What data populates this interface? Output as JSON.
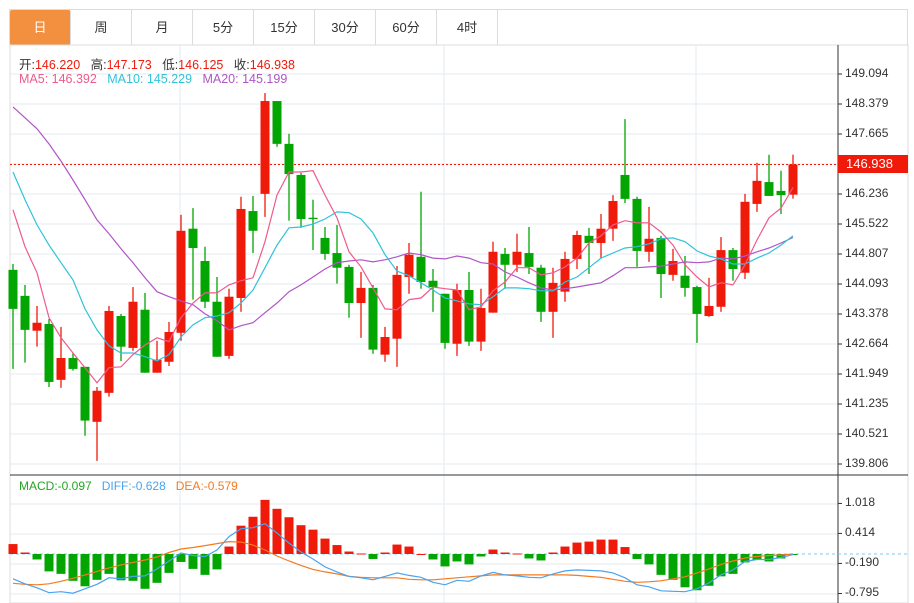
{
  "tabs": [
    {
      "label": "日",
      "active": true
    },
    {
      "label": "周"
    },
    {
      "label": "月"
    },
    {
      "label": "5分"
    },
    {
      "label": "15分"
    },
    {
      "label": "30分"
    },
    {
      "label": "60分"
    },
    {
      "label": "4时"
    }
  ],
  "ohlc_legend": {
    "open_label": "开:",
    "open": "146.220",
    "high_label": "高:",
    "high": "147.173",
    "low_label": "低:",
    "low": "146.125",
    "close_label": "收:",
    "close": "146.938"
  },
  "ma_legend": {
    "ma5": "MA5: 146.392",
    "ma10": "MA10: 145.229",
    "ma20": "MA20: 145.199"
  },
  "macd_legend": {
    "macd": "MACD:-0.097",
    "diff": "DIFF:-0.628",
    "dea": "DEA:-0.579"
  },
  "current_price": "146.938",
  "colors": {
    "up": "#f01a0a",
    "down": "#03a503",
    "ma5": "#ee5b8c",
    "ma10": "#2ec3d9",
    "ma20": "#b055c8",
    "diff": "#4aa3ee",
    "dea": "#f47a20",
    "accent": "#f39040"
  },
  "chart_data": [
    {
      "type": "candlestick",
      "price_axis": {
        "max": 149.094,
        "step": 0.7145,
        "labels": [
          "149.094",
          "148.379",
          "147.665",
          "",
          "146.236",
          "145.522",
          "144.807",
          "144.093",
          "143.378",
          "142.664",
          "141.949",
          "141.235",
          "140.521",
          "139.806"
        ]
      },
      "candles": [
        [
          144.43,
          144.57,
          142.07,
          143.5
        ],
        [
          143.81,
          144.07,
          142.22,
          143.0
        ],
        [
          142.98,
          143.57,
          142.6,
          143.17
        ],
        [
          143.14,
          143.26,
          141.64,
          141.76
        ],
        [
          141.81,
          143.07,
          141.62,
          142.33
        ],
        [
          142.33,
          142.45,
          142.03,
          142.07
        ],
        [
          142.12,
          142.12,
          140.48,
          140.84
        ],
        [
          140.81,
          141.64,
          139.88,
          141.55
        ],
        [
          141.5,
          143.57,
          141.41,
          143.45
        ],
        [
          143.33,
          143.38,
          142.26,
          142.6
        ],
        [
          142.57,
          144.02,
          142.5,
          143.67
        ],
        [
          143.48,
          143.88,
          141.98,
          141.98
        ],
        [
          141.98,
          142.74,
          141.98,
          142.29
        ],
        [
          142.24,
          143.19,
          142.14,
          142.95
        ],
        [
          142.93,
          145.74,
          142.74,
          145.36
        ],
        [
          145.41,
          145.9,
          143.72,
          144.95
        ],
        [
          144.64,
          144.98,
          143.52,
          143.67
        ],
        [
          143.67,
          144.26,
          142.36,
          142.36
        ],
        [
          142.38,
          143.98,
          142.31,
          143.79
        ],
        [
          143.76,
          146.17,
          143.43,
          145.88
        ],
        [
          145.83,
          146.19,
          144.83,
          145.36
        ],
        [
          146.24,
          148.64,
          145.69,
          148.45
        ],
        [
          148.45,
          148.45,
          147.36,
          147.43
        ],
        [
          147.43,
          147.67,
          145.6,
          146.71
        ],
        [
          146.69,
          146.74,
          145.43,
          145.64
        ],
        [
          145.67,
          146.1,
          144.9,
          145.64
        ],
        [
          145.19,
          145.45,
          144.67,
          144.81
        ],
        [
          144.83,
          145.5,
          144.1,
          144.48
        ],
        [
          144.5,
          144.55,
          143.29,
          143.64
        ],
        [
          143.64,
          144.38,
          142.81,
          144.0
        ],
        [
          144.0,
          144.07,
          142.43,
          142.53
        ],
        [
          142.41,
          143.07,
          142.24,
          142.83
        ],
        [
          142.79,
          144.52,
          142.12,
          144.31
        ],
        [
          144.26,
          145.07,
          143.86,
          144.79
        ],
        [
          144.74,
          146.29,
          143.98,
          144.14
        ],
        [
          144.17,
          144.45,
          143.43,
          144.02
        ],
        [
          143.86,
          143.86,
          142.55,
          142.69
        ],
        [
          142.67,
          144.1,
          142.38,
          143.95
        ],
        [
          143.95,
          144.38,
          142.62,
          142.72
        ],
        [
          142.72,
          143.98,
          142.5,
          143.52
        ],
        [
          143.41,
          145.1,
          143.41,
          144.86
        ],
        [
          144.81,
          144.95,
          143.98,
          144.55
        ],
        [
          144.55,
          145.29,
          144.38,
          144.86
        ],
        [
          144.83,
          145.45,
          144.33,
          144.5
        ],
        [
          144.48,
          144.55,
          143.19,
          143.43
        ],
        [
          143.43,
          144.48,
          142.81,
          144.12
        ],
        [
          143.91,
          144.86,
          143.67,
          144.69
        ],
        [
          144.69,
          145.36,
          144.45,
          145.26
        ],
        [
          145.24,
          145.43,
          144.33,
          145.07
        ],
        [
          145.07,
          145.76,
          144.71,
          145.41
        ],
        [
          145.41,
          146.21,
          145.12,
          146.07
        ],
        [
          146.69,
          148.02,
          146.02,
          146.12
        ],
        [
          146.12,
          146.17,
          144.5,
          144.88
        ],
        [
          144.86,
          145.93,
          144.62,
          145.17
        ],
        [
          145.19,
          145.24,
          143.76,
          144.33
        ],
        [
          144.31,
          144.93,
          144.17,
          144.64
        ],
        [
          144.29,
          144.76,
          143.79,
          144.0
        ],
        [
          144.02,
          144.05,
          142.69,
          143.38
        ],
        [
          143.33,
          144.24,
          143.31,
          143.57
        ],
        [
          143.55,
          145.21,
          143.43,
          144.9
        ],
        [
          144.9,
          144.95,
          144.17,
          144.45
        ],
        [
          144.36,
          146.24,
          144.21,
          146.05
        ],
        [
          146.0,
          146.98,
          145.81,
          146.55
        ],
        [
          146.52,
          147.17,
          146.19,
          146.19
        ],
        [
          146.31,
          146.79,
          145.76,
          146.21
        ],
        [
          146.22,
          147.173,
          146.125,
          146.938
        ]
      ],
      "ma5": [
        145.86,
        144.98,
        144.36,
        143.29,
        142.81,
        142.45,
        142.1,
        141.74,
        142.1,
        142.12,
        142.41,
        142.64,
        142.81,
        142.72,
        143.29,
        143.64,
        143.88,
        143.88,
        144.07,
        144.17,
        144.24,
        145.1,
        146.21,
        146.76,
        146.76,
        146.79,
        146.21,
        145.67,
        144.86,
        144.5,
        144.0,
        143.5,
        143.48,
        143.72,
        143.76,
        144.02,
        143.98,
        143.95,
        143.48,
        143.55,
        143.93,
        144.14,
        144.48,
        144.48,
        144.31,
        144.36,
        144.5,
        144.71,
        145.07,
        145.24,
        145.5,
        145.6,
        145.55,
        145.55,
        145.33,
        145.02,
        144.55,
        144.26,
        144.02,
        144.12,
        144.07,
        144.55,
        145.14,
        145.67,
        145.9,
        146.39
      ],
      "ma10": [
        146.76,
        146.1,
        145.5,
        145.02,
        144.6,
        144.19,
        143.5,
        143.0,
        142.62,
        142.45,
        142.45,
        142.36,
        142.26,
        142.41,
        142.83,
        143.12,
        143.29,
        143.33,
        143.41,
        143.64,
        143.95,
        144.48,
        145.02,
        145.43,
        145.45,
        145.52,
        145.64,
        145.81,
        145.79,
        145.64,
        145.31,
        144.79,
        144.4,
        144.29,
        144.12,
        143.95,
        143.76,
        143.69,
        143.62,
        143.6,
        143.79,
        144.0,
        144.0,
        143.98,
        143.93,
        143.93,
        144.14,
        144.26,
        144.48,
        144.71,
        144.83,
        144.95,
        144.98,
        145.05,
        145.17,
        145.19,
        145.1,
        144.88,
        144.76,
        144.69,
        144.57,
        144.57,
        144.71,
        144.83,
        145.02,
        145.24
      ],
      "ma20": [
        148.31,
        148.05,
        147.79,
        147.43,
        147.02,
        146.57,
        146.1,
        145.62,
        145.29,
        144.93,
        144.6,
        144.24,
        143.91,
        143.79,
        143.69,
        143.6,
        143.38,
        143.22,
        143.0,
        143.1,
        143.17,
        143.41,
        143.64,
        143.91,
        144.07,
        144.26,
        144.45,
        144.6,
        144.64,
        144.67,
        144.62,
        144.67,
        144.74,
        144.83,
        144.79,
        144.71,
        144.69,
        144.76,
        144.71,
        144.6,
        144.57,
        144.38,
        144.26,
        144.12,
        144.0,
        143.95,
        143.98,
        144.02,
        144.07,
        144.12,
        144.29,
        144.48,
        144.48,
        144.5,
        144.52,
        144.57,
        144.62,
        144.6,
        144.62,
        144.71,
        144.69,
        144.76,
        144.86,
        144.95,
        145.07,
        145.2
      ]
    },
    {
      "type": "bar+line",
      "title": "MACD",
      "y_axis": {
        "labels": [
          "1.018",
          "0.414",
          "-0.190",
          "-0.795"
        ],
        "values": [
          1.018,
          0.414,
          -0.19,
          -0.795
        ]
      },
      "macd": [
        0.2,
        0.03,
        -0.11,
        -0.35,
        -0.4,
        -0.54,
        -0.65,
        -0.52,
        -0.4,
        -0.53,
        -0.54,
        -0.7,
        -0.58,
        -0.38,
        -0.16,
        -0.3,
        -0.42,
        -0.31,
        0.15,
        0.57,
        0.75,
        1.09,
        0.91,
        0.74,
        0.58,
        0.49,
        0.31,
        0.18,
        0.05,
        0.01,
        -0.1,
        0.03,
        0.19,
        0.15,
        0.0,
        -0.11,
        -0.25,
        -0.15,
        -0.21,
        -0.05,
        0.09,
        0.03,
        0.01,
        -0.09,
        -0.13,
        0.03,
        0.15,
        0.23,
        0.25,
        0.29,
        0.29,
        0.14,
        -0.1,
        -0.21,
        -0.42,
        -0.52,
        -0.67,
        -0.73,
        -0.64,
        -0.45,
        -0.4,
        -0.17,
        -0.12,
        -0.15,
        -0.09,
        -0.02
      ],
      "diff": [
        -0.5,
        -0.6,
        -0.68,
        -0.78,
        -0.76,
        -0.79,
        -0.7,
        -0.61,
        -0.48,
        -0.5,
        -0.45,
        -0.44,
        -0.3,
        -0.14,
        0.02,
        -0.03,
        -0.05,
        0.08,
        0.35,
        0.51,
        0.53,
        0.61,
        0.42,
        0.22,
        0.04,
        -0.1,
        -0.26,
        -0.36,
        -0.45,
        -0.48,
        -0.52,
        -0.45,
        -0.38,
        -0.43,
        -0.47,
        -0.57,
        -0.62,
        -0.53,
        -0.55,
        -0.44,
        -0.37,
        -0.42,
        -0.44,
        -0.47,
        -0.48,
        -0.4,
        -0.34,
        -0.32,
        -0.33,
        -0.34,
        -0.38,
        -0.48,
        -0.62,
        -0.66,
        -0.74,
        -0.75,
        -0.76,
        -0.7,
        -0.58,
        -0.42,
        -0.32,
        -0.15,
        -0.11,
        -0.11,
        -0.07,
        -0.01
      ],
      "dea": [
        -0.59,
        -0.61,
        -0.62,
        -0.6,
        -0.55,
        -0.49,
        -0.42,
        -0.35,
        -0.28,
        -0.22,
        -0.17,
        -0.12,
        -0.06,
        0.03,
        0.1,
        0.13,
        0.17,
        0.21,
        0.25,
        0.24,
        0.18,
        0.08,
        -0.04,
        -0.14,
        -0.23,
        -0.31,
        -0.36,
        -0.4,
        -0.45,
        -0.47,
        -0.48,
        -0.48,
        -0.48,
        -0.51,
        -0.52,
        -0.52,
        -0.5,
        -0.48,
        -0.46,
        -0.44,
        -0.42,
        -0.42,
        -0.42,
        -0.42,
        -0.42,
        -0.42,
        -0.42,
        -0.43,
        -0.45,
        -0.47,
        -0.51,
        -0.55,
        -0.57,
        -0.56,
        -0.54,
        -0.5,
        -0.46,
        -0.38,
        -0.3,
        -0.21,
        -0.14,
        -0.08,
        -0.05,
        -0.03,
        -0.02,
        0.0
      ]
    }
  ]
}
